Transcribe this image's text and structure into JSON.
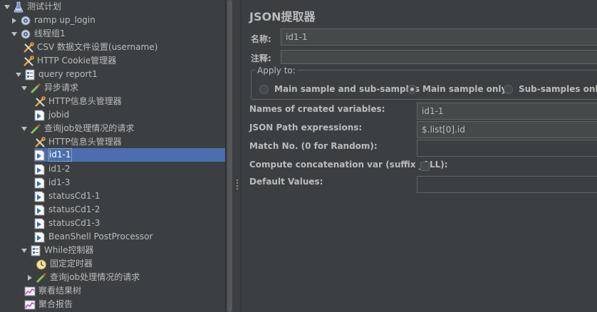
{
  "tree": {
    "items": [
      {
        "label": "测试计划",
        "icon": "test-plan-icon",
        "toggle": "expanded"
      },
      {
        "label": "ramp up_login",
        "icon": "gear-icon",
        "toggle": "collapsed"
      },
      {
        "label": "线程组1",
        "icon": "gear-icon",
        "toggle": "expanded"
      },
      {
        "label": "CSV 数据文件设置(username)",
        "icon": "wrench-icon",
        "toggle": ""
      },
      {
        "label": "HTTP Cookie管理器",
        "icon": "wrench-icon",
        "toggle": ""
      },
      {
        "label": "query report1",
        "icon": "controller-icon",
        "toggle": "expanded"
      },
      {
        "label": "异步请求",
        "icon": "pipette-icon",
        "toggle": "expanded"
      },
      {
        "label": "HTTP信息头管理器",
        "icon": "wrench-icon",
        "toggle": ""
      },
      {
        "label": "jobid",
        "icon": "extractor-icon",
        "toggle": ""
      },
      {
        "label": "查询job处理情况的请求",
        "icon": "pipette-icon",
        "toggle": "expanded"
      },
      {
        "label": "HTTP信息头管理器",
        "icon": "wrench-icon",
        "toggle": ""
      },
      {
        "label": "id1-1",
        "icon": "extractor-icon",
        "toggle": "",
        "selected": true
      },
      {
        "label": "id1-2",
        "icon": "extractor-icon",
        "toggle": ""
      },
      {
        "label": "id1-3",
        "icon": "extractor-icon",
        "toggle": ""
      },
      {
        "label": "statusCd1-1",
        "icon": "extractor-icon",
        "toggle": ""
      },
      {
        "label": "statusCd1-2",
        "icon": "extractor-icon",
        "toggle": ""
      },
      {
        "label": "statusCd1-3",
        "icon": "extractor-icon",
        "toggle": ""
      },
      {
        "label": "BeanShell PostProcessor",
        "icon": "extractor-icon",
        "toggle": ""
      },
      {
        "label": "While控制器",
        "icon": "controller-icon",
        "toggle": "expanded"
      },
      {
        "label": "固定定时器",
        "icon": "timer-icon",
        "toggle": ""
      },
      {
        "label": "查询job处理情况的请求",
        "icon": "pipette-icon",
        "toggle": "collapsed"
      },
      {
        "label": "察看结果树",
        "icon": "listener-icon",
        "toggle": ""
      },
      {
        "label": "聚合报告",
        "icon": "listener-icon",
        "toggle": ""
      }
    ]
  },
  "panel": {
    "title": "JSON提取器",
    "name_label": "名称:",
    "name_value": "id1-1",
    "comment_label": "注释:",
    "comment_value": "",
    "apply_to": {
      "legend": "Apply to:",
      "options": [
        "Main sample and sub-samples",
        "Main sample only",
        "Sub-samples only"
      ],
      "selected": "Main sample only"
    },
    "fields": [
      {
        "label": "Names of created variables:",
        "value": "id1-1"
      },
      {
        "label": "JSON Path expressions:",
        "value": "$.list[0].id"
      },
      {
        "label": "Match No. (0 for Random):",
        "value": ""
      },
      {
        "label": "Compute concatenation var (suffix _ALL):",
        "value": ""
      },
      {
        "label": "Default Values:",
        "value": ""
      }
    ]
  },
  "colors": {
    "background": "#3c3f41",
    "selection": "#4b6eaf",
    "text": "#bbbbbb"
  }
}
